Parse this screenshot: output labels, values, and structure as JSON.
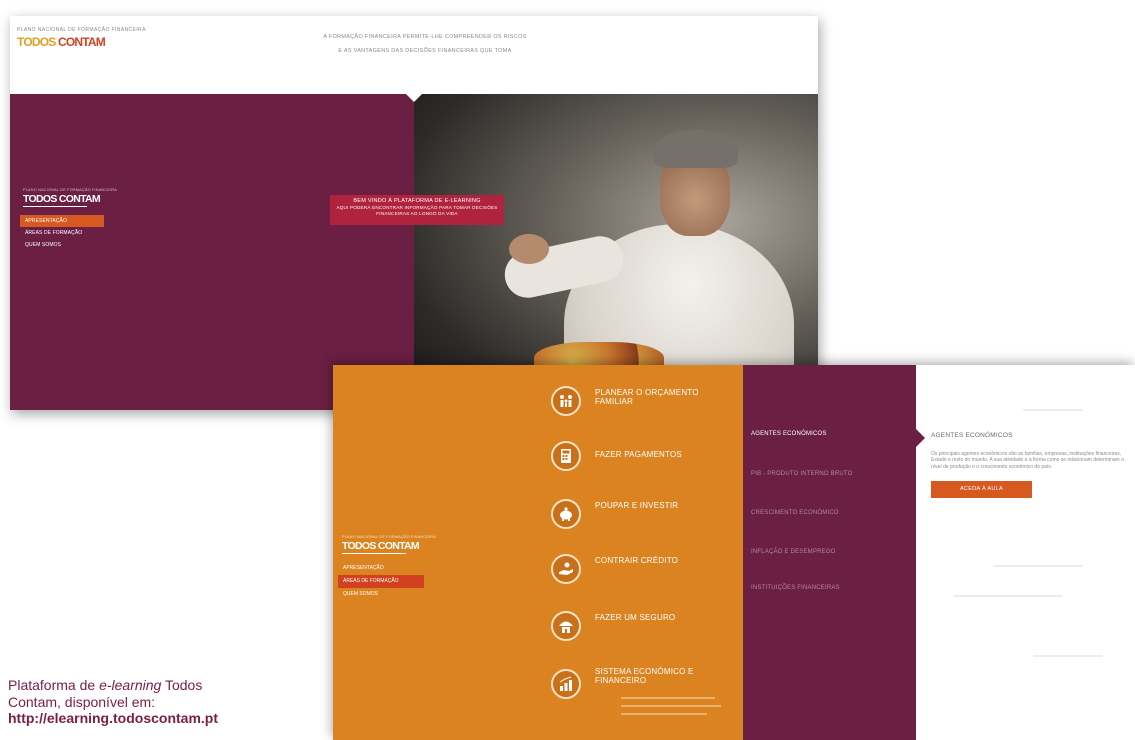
{
  "shot1": {
    "logo": {
      "tagline": "PLANO NACIONAL DE FORMAÇÃO FINANCEIRA",
      "brand_a": "TODOS",
      "brand_b": "CONTAM"
    },
    "slogan": {
      "line1": "A FORMAÇÃO FINANCEIRA PERMITE-LHE COMPREENDER OS RISCOS",
      "line2": "E AS VANTAGENS DAS DECISÕES FINANCEIRAS QUE TOMA"
    },
    "side_logo": {
      "tagline": "PLANO NACIONAL DE FORMAÇÃO FINANCEIRA",
      "brand": "TODOS CONTAM"
    },
    "menu": [
      {
        "label": "APRESENTAÇÃO",
        "active": true
      },
      {
        "label": "ÁREAS DE FORMAÇÃO",
        "active": false
      },
      {
        "label": "QUEM SOMOS",
        "active": false
      }
    ],
    "welcome": {
      "title": "BEM VINDO À PLATAFORMA DE E-LEARNING",
      "subtitle": "AQUI PODERÁ ENCONTRAR INFORMAÇÃO PARA TOMAR DECISÕES FINANCEIRAS AO LONGO DA VIDA"
    }
  },
  "shot2": {
    "side_logo": {
      "tagline": "PLANO NACIONAL DE FORMAÇÃO FINANCEIRA",
      "brand": "TODOS CONTAM"
    },
    "menu": [
      {
        "label": "APRESENTAÇÃO",
        "active": false
      },
      {
        "label": "ÁREAS DE FORMAÇÃO",
        "active": true
      },
      {
        "label": "QUEM SOMOS",
        "active": false
      }
    ],
    "categories": [
      {
        "label": "PLANEAR O ORÇAMENTO FAMILIAR",
        "icon": "family-icon"
      },
      {
        "label": "FAZER PAGAMENTOS",
        "icon": "calculator-icon"
      },
      {
        "label": "POUPAR E INVESTIR",
        "icon": "piggy-bank-icon"
      },
      {
        "label": "CONTRAIR CRÉDITO",
        "icon": "credit-hand-icon"
      },
      {
        "label": "FAZER UM SEGURO",
        "icon": "insurance-umbrella-icon"
      },
      {
        "label": "SISTEMA ECONÓMICO E FINANCEIRO",
        "icon": "chart-icon"
      }
    ],
    "topics": [
      {
        "label": "AGENTES ECONÓMICOS",
        "active": true
      },
      {
        "label": "PIB - PRODUTO INTERNO BRUTO",
        "active": false
      },
      {
        "label": "CRESCIMENTO ECONÓMICO",
        "active": false
      },
      {
        "label": "INFLAÇÃO E DESEMPREGO",
        "active": false
      },
      {
        "label": "INSTITUIÇÕES FINANCEIRAS",
        "active": false
      }
    ],
    "detail": {
      "title": "AGENTES ECONÓMICOS",
      "description": "Os principais agentes económicos são as famílias, empresas, instituições financeiras, Estado e resto do mundo. A sua atividade e a forma como se relacionam determinam o nível de produção e o crescimento económico do país.",
      "button": "ACEDA À AULA"
    }
  },
  "caption": {
    "line1_prefix": "Plataforma de ",
    "line1_italic": "e-learning",
    "line1_suffix": " Todos",
    "line2": "Contam, disponível em:",
    "url": "http://elearning.todoscontam.pt"
  },
  "colors": {
    "purple": "#6a1f43",
    "orange": "#db8320",
    "accent_orange": "#d65a1f",
    "red": "#d2411f",
    "welcome_red": "#b0233f",
    "caption": "#7a1e45"
  }
}
